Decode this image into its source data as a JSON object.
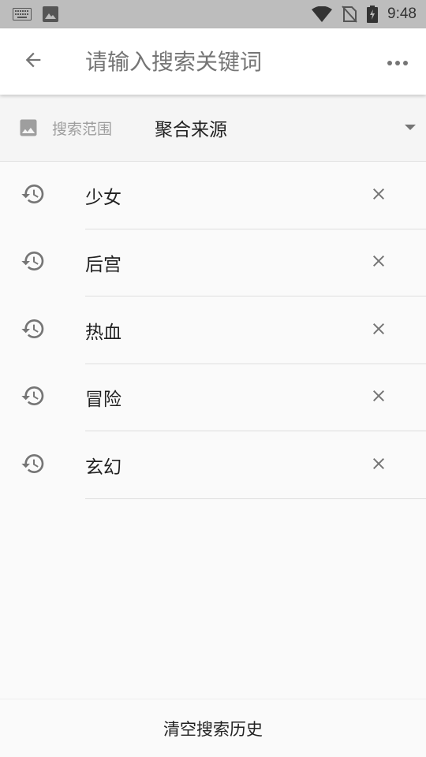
{
  "status_bar": {
    "time": "9:48",
    "icons": [
      "keyboard-icon",
      "image-icon",
      "wifi-icon",
      "no-sim-icon",
      "battery-charging-icon"
    ]
  },
  "app_bar": {
    "search_placeholder": "请输入搜索关键词",
    "back_icon": "arrow-back-icon",
    "more_icon": "more-horiz-icon"
  },
  "scope": {
    "label": "搜索范围",
    "value": "聚合来源",
    "icon": "image-icon"
  },
  "history": {
    "items": [
      {
        "text": "少女"
      },
      {
        "text": "后宫"
      },
      {
        "text": "热血"
      },
      {
        "text": "冒险"
      },
      {
        "text": "玄幻"
      }
    ]
  },
  "footer": {
    "clear_label": "清空搜索历史"
  },
  "colors": {
    "status_bar": "#bdbdbd",
    "icon_gray": "#757575",
    "text_primary": "#212121",
    "text_secondary": "#9e9e9e"
  }
}
